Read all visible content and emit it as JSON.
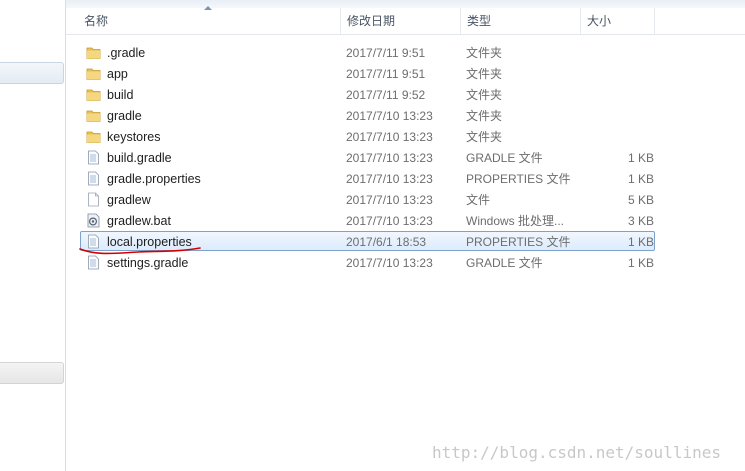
{
  "columns": {
    "name": "名称",
    "date": "修改日期",
    "type": "类型",
    "size": "大小"
  },
  "files": [
    {
      "name": ".gradle",
      "date": "2017/7/11 9:51",
      "type": "文件夹",
      "size": "",
      "icon": "folder-icon"
    },
    {
      "name": "app",
      "date": "2017/7/11 9:51",
      "type": "文件夹",
      "size": "",
      "icon": "folder-icon"
    },
    {
      "name": "build",
      "date": "2017/7/11 9:52",
      "type": "文件夹",
      "size": "",
      "icon": "folder-icon"
    },
    {
      "name": "gradle",
      "date": "2017/7/10 13:23",
      "type": "文件夹",
      "size": "",
      "icon": "folder-icon"
    },
    {
      "name": "keystores",
      "date": "2017/7/10 13:23",
      "type": "文件夹",
      "size": "",
      "icon": "folder-icon"
    },
    {
      "name": "build.gradle",
      "date": "2017/7/10 13:23",
      "type": "GRADLE 文件",
      "size": "1 KB",
      "icon": "document-icon"
    },
    {
      "name": "gradle.properties",
      "date": "2017/7/10 13:23",
      "type": "PROPERTIES 文件",
      "size": "1 KB",
      "icon": "document-icon"
    },
    {
      "name": "gradlew",
      "date": "2017/7/10 13:23",
      "type": "文件",
      "size": "5 KB",
      "icon": "blank-file-icon"
    },
    {
      "name": "gradlew.bat",
      "date": "2017/7/10 13:23",
      "type": "Windows 批处理...",
      "size": "3 KB",
      "icon": "batch-file-icon"
    },
    {
      "name": "local.properties",
      "date": "2017/6/1 18:53",
      "type": "PROPERTIES 文件",
      "size": "1 KB",
      "icon": "document-icon",
      "selected": true
    },
    {
      "name": "settings.gradle",
      "date": "2017/7/10 13:23",
      "type": "GRADLE 文件",
      "size": "1 KB",
      "icon": "document-icon"
    }
  ],
  "colors": {
    "selection_border": "#7da2ce",
    "folder": "#e8c05a",
    "annotation": "#d40000"
  },
  "watermark": "http://blog.csdn.net/soullines"
}
